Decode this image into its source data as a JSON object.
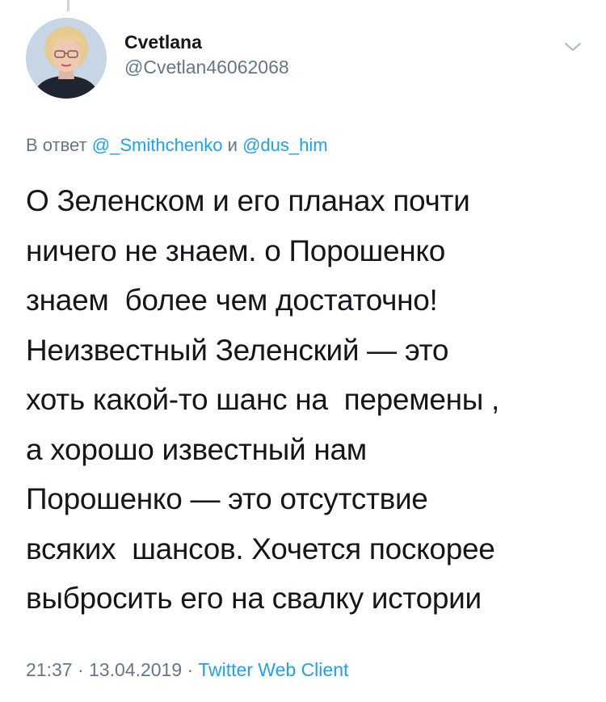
{
  "tweet": {
    "author": {
      "display_name": "Cvetlana",
      "handle": "@Cvetlan46062068"
    },
    "reply_to": {
      "prefix": "В ответ",
      "mention_1": "@_Smithchenko",
      "conjunction": "и",
      "mention_2": "@dus_him"
    },
    "text_lines": [
      "О Зеленском и его планах почти",
      "ничего не знаем. о Порошенко",
      "знаем  более чем достаточно!",
      "Неизвестный Зеленский — это",
      "хоть какой-то шанс на  перемены ,",
      "а хорошо известный нам",
      "Порошенко — это отсутствие",
      "всяких  шансов. Хочется поскорее",
      "выбросить его на свалку истории"
    ],
    "time": "21:37",
    "separator": "·",
    "date": "13.04.2019",
    "source": "Twitter Web Client"
  },
  "icons": {
    "more": "chevron-down-icon",
    "avatar": "avatar-photo"
  },
  "colors": {
    "text": "#14171a",
    "secondary": "#657786",
    "link": "#1da1f2"
  }
}
